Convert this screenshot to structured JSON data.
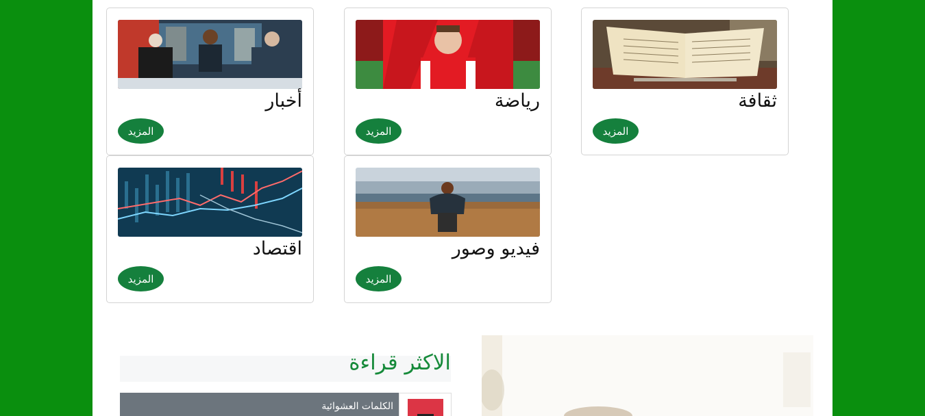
{
  "categories": [
    {
      "title": "أخبار",
      "more_label": "المزيد",
      "icon": "news-studio-image"
    },
    {
      "title": "رياضة",
      "more_label": "المزيد",
      "icon": "football-player-image"
    },
    {
      "title": "ثقافة",
      "more_label": "المزيد",
      "icon": "open-book-image"
    },
    {
      "title": "اقتصاد",
      "more_label": "المزيد",
      "icon": "stock-chart-image"
    },
    {
      "title": "فيديو وصور",
      "more_label": "المزيد",
      "icon": "person-field-image"
    }
  ],
  "most_read": {
    "title": "الاكثر قراءة",
    "items": [
      {
        "label": "الكلمات العشوائية"
      }
    ]
  },
  "colors": {
    "page_background": "#0a8f0e",
    "button": "#15803d",
    "heading_accent": "#168a3a"
  }
}
